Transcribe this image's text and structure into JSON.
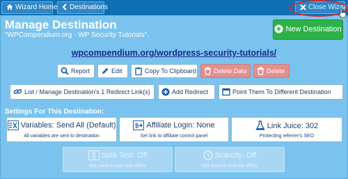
{
  "toolbar": {
    "wizard_home": "Wizard Home",
    "destinations": "Destinations",
    "close_wizard": "Close Wizard"
  },
  "header": {
    "title": "Manage Destination",
    "subtitle": "\"WPCompendium.org - WP Security Tutorials\".",
    "new_destination": "New Destination"
  },
  "destination_url": "wpcompendium.org/wordpress-security-tutorials/",
  "actions": {
    "report": "Report",
    "edit": "Edit",
    "copy": "Copy To Clipboard",
    "delete_data": "Delete Data",
    "delete": "Delete"
  },
  "redirects": {
    "list": "List / Manage Destination's 1 Redirect Link(s)",
    "add": "Add Redirect",
    "point": "Point Them To Different Destination"
  },
  "settings": {
    "heading": "Settings For This Destination:",
    "variables": {
      "label": "Variables: Send All (Default)",
      "sub": "All variables are sent to destination"
    },
    "affiliate": {
      "label": "Affiliate Login: None",
      "sub": "Set link to affiliate control panel"
    },
    "juice": {
      "label": "Link Juice: 302",
      "sub": "Protecting referrer's SEO"
    },
    "split": {
      "label": "Split-Test: Off",
      "sub": "Not used in split-test offers"
    },
    "scarcity": {
      "label": "Scarcity: Off",
      "sub": "Not used in scarcity offers"
    }
  },
  "colors": {
    "panel": "#7ac3ee",
    "toolbar": "#0f6fb3",
    "new_button": "#2db24a",
    "delete_button": "#e58e8e",
    "highlight": "#d9262b"
  }
}
